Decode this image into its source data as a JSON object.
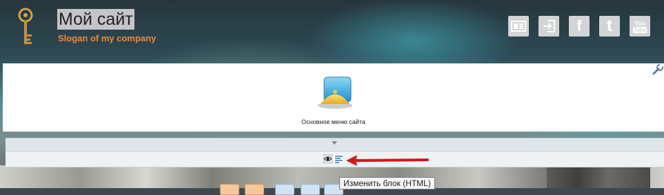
{
  "header": {
    "title": "Мой сайт",
    "slogan": "Slogan of my company",
    "social": [
      {
        "name": "contact-card-icon"
      },
      {
        "name": "login-icon"
      },
      {
        "name": "facebook-icon",
        "glyph": "f"
      },
      {
        "name": "twitter-icon",
        "glyph": "t"
      },
      {
        "name": "youtube-icon",
        "glyph_top": "You",
        "glyph_bottom": "Tube"
      }
    ]
  },
  "content": {
    "menu_label": "Основное меню сайта"
  },
  "admin": {
    "tooltip": "Изменить блок (HTML)"
  },
  "colors": {
    "slogan": "#f0873a",
    "accent_red": "#d01818"
  }
}
